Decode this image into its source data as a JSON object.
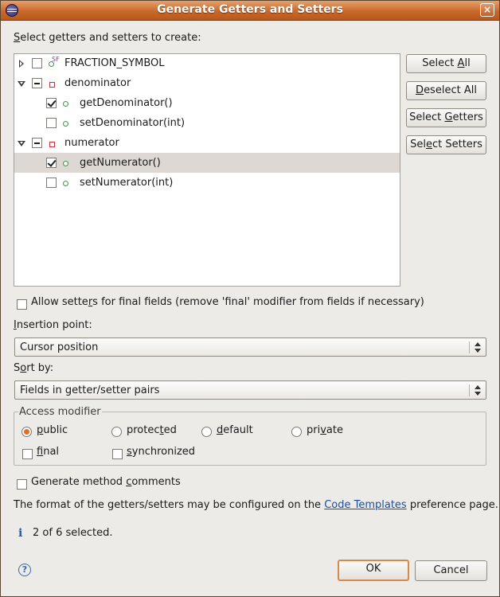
{
  "window": {
    "title": "Generate Getters and Setters",
    "close_label": "×"
  },
  "tree": {
    "heading_prefix": "S",
    "heading_rest": "elect getters and setters to create:",
    "items": [
      {
        "label": "FRACTION_SYMBOL",
        "icon": "static-final-field-icon",
        "state": "unchecked",
        "expanded": false
      },
      {
        "label": "denominator",
        "icon": "private-field-icon",
        "state": "mixed",
        "expanded": true
      },
      {
        "label": "getDenominator()",
        "icon": "method-icon",
        "state": "checked"
      },
      {
        "label": "setDenominator(int)",
        "icon": "method-icon",
        "state": "unchecked"
      },
      {
        "label": "numerator",
        "icon": "private-field-icon",
        "state": "mixed",
        "expanded": true
      },
      {
        "label": "getNumerator()",
        "icon": "method-icon",
        "state": "checked",
        "selected": true
      },
      {
        "label": "setNumerator(int)",
        "icon": "method-icon",
        "state": "unchecked"
      }
    ],
    "static_final_marker": "SF"
  },
  "buttons": {
    "select_all": {
      "pre": "Select ",
      "u": "A",
      "post": "ll"
    },
    "deselect_all": {
      "pre": "",
      "u": "D",
      "post": "eselect All"
    },
    "select_getters": {
      "pre": "Select ",
      "u": "G",
      "post": "etters"
    },
    "select_setters": {
      "pre": "Sel",
      "u": "e",
      "post": "ct Setters"
    },
    "ok": "OK",
    "cancel": "Cancel"
  },
  "allow_setters": {
    "pre": "Allow sette",
    "u": "r",
    "post": "s for final fields (remove 'final' modifier from fields if necessary)",
    "checked": false
  },
  "insertion": {
    "label_u": "I",
    "label_rest": "nsertion point:",
    "value": "Cursor position"
  },
  "sort": {
    "label_pre": "S",
    "label_u": "o",
    "label_rest": "rt by:",
    "value": "Fields in getter/setter pairs"
  },
  "access": {
    "legend": "Access modifier",
    "radios": [
      {
        "pre": "",
        "u": "p",
        "post": "ublic",
        "checked": true
      },
      {
        "pre": "protec",
        "u": "t",
        "post": "ed",
        "checked": false
      },
      {
        "pre": "",
        "u": "d",
        "post": "efault",
        "checked": false
      },
      {
        "pre": "pri",
        "u": "v",
        "post": "ate",
        "checked": false
      }
    ],
    "final": {
      "pre": "",
      "u": "f",
      "post": "inal",
      "checked": false
    },
    "synchronized": {
      "pre": "",
      "u": "s",
      "post": "ynchronized",
      "checked": false
    }
  },
  "comments": {
    "pre": "Generate method ",
    "u": "c",
    "post": "omments",
    "checked": false
  },
  "info": {
    "pre": "The format of the getters/setters may be configured on the ",
    "link": "Code Templates",
    "post": " preference page.",
    "status": "2 of 6 selected."
  },
  "colors": {
    "titlebar": "#c8692b",
    "accent": "#e07020",
    "link": "#1a4fa0"
  }
}
